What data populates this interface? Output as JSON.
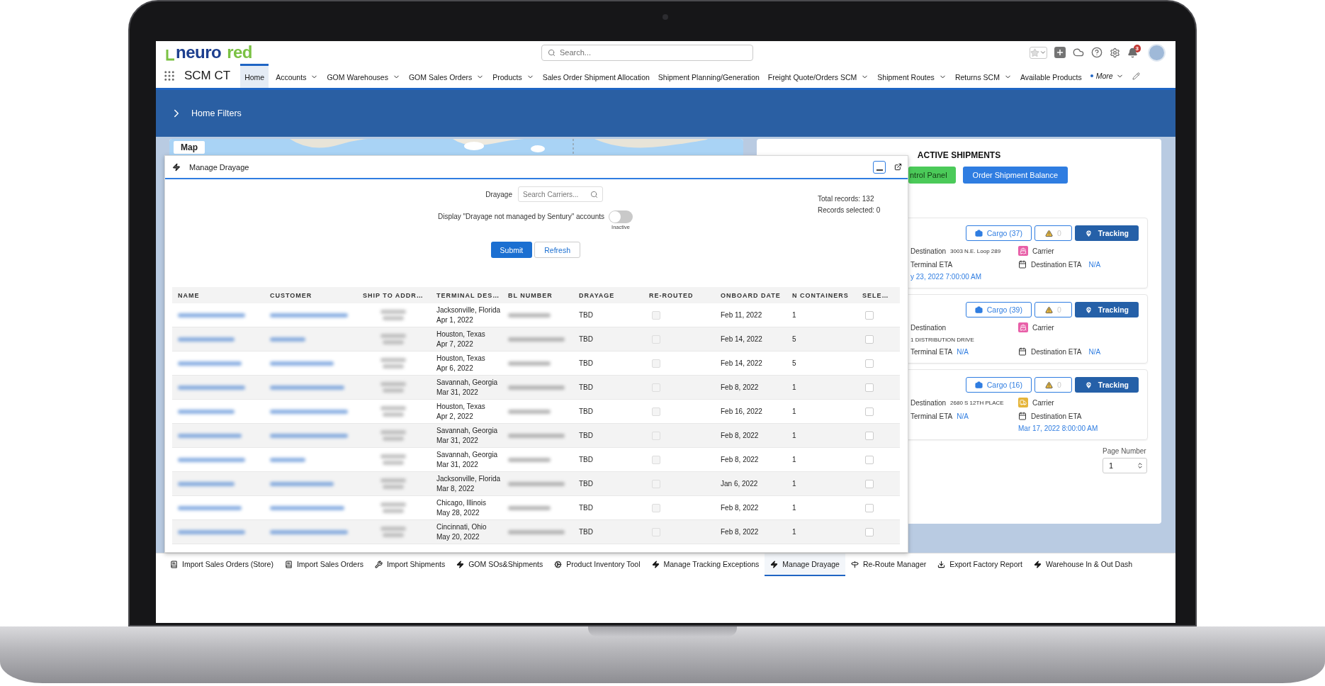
{
  "header": {
    "logo": {
      "primary": "neuro",
      "secondary": "red"
    },
    "search": {
      "placeholder": "Search..."
    },
    "notifications": "3"
  },
  "nav": {
    "app_name": "SCM CT",
    "tabs": [
      {
        "label": "Home",
        "selected": true,
        "dropdown": false
      },
      {
        "label": "Accounts",
        "selected": false,
        "dropdown": true
      },
      {
        "label": "GOM Warehouses",
        "selected": false,
        "dropdown": true
      },
      {
        "label": "GOM Sales Orders",
        "selected": false,
        "dropdown": true
      },
      {
        "label": "Products",
        "selected": false,
        "dropdown": true
      },
      {
        "label": "Sales Order Shipment Allocation",
        "selected": false,
        "dropdown": false
      },
      {
        "label": "Shipment Planning/Generation",
        "selected": false,
        "dropdown": false
      },
      {
        "label": "Freight Quote/Orders SCM",
        "selected": false,
        "dropdown": true
      },
      {
        "label": "Shipment Routes",
        "selected": false,
        "dropdown": true
      },
      {
        "label": "Returns SCM",
        "selected": false,
        "dropdown": true
      },
      {
        "label": "Available Products",
        "selected": false,
        "dropdown": false
      }
    ],
    "more": {
      "label": "More",
      "edited": true
    }
  },
  "filters_bar": {
    "label": "Home Filters"
  },
  "map_card": {
    "title": "Map"
  },
  "active_shipments": {
    "title": "ACTIVE SHIPMENTS",
    "buttons": [
      {
        "label": "ntrol Panel",
        "kind": "green"
      },
      {
        "label": "Order Shipment Balance",
        "kind": "blue"
      }
    ],
    "shipments": [
      {
        "cargo": "Cargo (37)",
        "alerts": "0",
        "tracking": "Tracking",
        "destination": {
          "label": "Destination",
          "value": "3003 N.E. Loop 289",
          "kind": "inline"
        },
        "carrier": {
          "label": "Carrier",
          "kind": "ship",
          "color": "#e85fa8"
        },
        "terminal_eta_label": "Terminal ETA",
        "destination_eta_label": "Destination ETA",
        "destination_eta": "N/A",
        "eta_date": {
          "text": "y 23, 2022 7:00:00 AM",
          "kind": "left"
        }
      },
      {
        "cargo": "Cargo (39)",
        "alerts": "0",
        "tracking": "Tracking",
        "destination": {
          "label": "Destination",
          "value": "1 DISTRIBUTION DRIVE",
          "kind": "below"
        },
        "carrier": {
          "label": "Carrier",
          "kind": "ship",
          "color": "#e85fa8"
        },
        "terminal_eta_label": "Terminal ETA",
        "terminal_eta": "N/A",
        "destination_eta_label": "Destination ETA",
        "destination_eta": "N/A"
      },
      {
        "cargo": "Cargo (16)",
        "alerts": "0",
        "tracking": "Tracking",
        "destination": {
          "label": "Destination",
          "value": "2680 S 12TH PLACE",
          "kind": "inline"
        },
        "carrier": {
          "label": "Carrier",
          "kind": "truck",
          "color": "#e5b53b"
        },
        "terminal_eta_label": "Terminal ETA",
        "terminal_eta": "N/A",
        "destination_eta_label": "Destination ETA",
        "eta_date": {
          "text": "Mar 17, 2022 8:00:00 AM",
          "kind": "right"
        }
      }
    ],
    "page_number": {
      "label": "Page Number",
      "value": "1"
    }
  },
  "modal": {
    "title": "Manage Drayage",
    "drayage": {
      "label": "Drayage",
      "placeholder": "Search Carriers..."
    },
    "toggle": {
      "label": "Display \"Drayage not managed by Sentury\" accounts",
      "on": false,
      "state_label": "Inactive"
    },
    "totals": [
      "Total records: 132",
      "Records selected: 0"
    ],
    "buttons": {
      "submit": "Submit",
      "refresh": "Refresh"
    },
    "table": {
      "columns": [
        "NAME",
        "CUSTOMER",
        "SHIP TO ADDR…",
        "TERMINAL DES…",
        "BL NUMBER",
        "DRAYAGE",
        "RE-ROUTED",
        "ONBOARD DATE",
        "N CONTAINERS",
        "SELE…"
      ],
      "rows": [
        {
          "terminal": "Jacksonville, Florida",
          "terminal_date": "Apr 1, 2022",
          "drayage": "TBD",
          "re_routed": false,
          "onboard_date": "Feb 11, 2022",
          "containers": "1",
          "selected": false
        },
        {
          "terminal": "Houston, Texas",
          "terminal_date": "Apr 7, 2022",
          "drayage": "TBD",
          "re_routed": false,
          "onboard_date": "Feb 14, 2022",
          "containers": "5",
          "selected": false
        },
        {
          "terminal": "Houston, Texas",
          "terminal_date": "Apr 6, 2022",
          "drayage": "TBD",
          "re_routed": false,
          "onboard_date": "Feb 14, 2022",
          "containers": "5",
          "selected": false
        },
        {
          "terminal": "Savannah, Georgia",
          "terminal_date": "Mar 31, 2022",
          "drayage": "TBD",
          "re_routed": false,
          "onboard_date": "Feb 8, 2022",
          "containers": "1",
          "selected": false
        },
        {
          "terminal": "Houston, Texas",
          "terminal_date": "Apr 2, 2022",
          "drayage": "TBD",
          "re_routed": false,
          "onboard_date": "Feb 16, 2022",
          "containers": "1",
          "selected": false
        },
        {
          "terminal": "Savannah, Georgia",
          "terminal_date": "Mar 31, 2022",
          "drayage": "TBD",
          "re_routed": false,
          "onboard_date": "Feb 8, 2022",
          "containers": "1",
          "selected": false
        },
        {
          "terminal": "Savannah, Georgia",
          "terminal_date": "Mar 31, 2022",
          "drayage": "TBD",
          "re_routed": false,
          "onboard_date": "Feb 8, 2022",
          "containers": "1",
          "selected": false
        },
        {
          "terminal": "Jacksonville, Florida",
          "terminal_date": "Mar 8, 2022",
          "drayage": "TBD",
          "re_routed": false,
          "onboard_date": "Jan 6, 2022",
          "containers": "1",
          "selected": false
        },
        {
          "terminal": "Chicago, Illinois",
          "terminal_date": "May 28, 2022",
          "drayage": "TBD",
          "re_routed": false,
          "onboard_date": "Feb 8, 2022",
          "containers": "1",
          "selected": false
        },
        {
          "terminal": "Cincinnati, Ohio",
          "terminal_date": "May 20, 2022",
          "drayage": "TBD",
          "re_routed": false,
          "onboard_date": "Feb 8, 2022",
          "containers": "1",
          "selected": false
        }
      ]
    }
  },
  "utility_bar": [
    {
      "label": "Import Sales Orders (Store)",
      "kind": "ledger",
      "selected": false
    },
    {
      "label": "Import Sales Orders",
      "kind": "ledger",
      "selected": false
    },
    {
      "label": "Import Shipments",
      "kind": "tool",
      "selected": false
    },
    {
      "label": "GOM SOs&Shipments",
      "kind": "bolt",
      "selected": false
    },
    {
      "label": "Product Inventory Tool",
      "kind": "gear",
      "selected": false
    },
    {
      "label": "Manage Tracking Exceptions",
      "kind": "bolt",
      "selected": false
    },
    {
      "label": "Manage Drayage",
      "kind": "bolt",
      "selected": true
    },
    {
      "label": "Re-Route Manager",
      "kind": "signpost",
      "selected": false
    },
    {
      "label": "Export Factory Report",
      "kind": "download",
      "selected": false
    },
    {
      "label": "Warehouse In & Out Dash",
      "kind": "bolt",
      "selected": false
    }
  ]
}
